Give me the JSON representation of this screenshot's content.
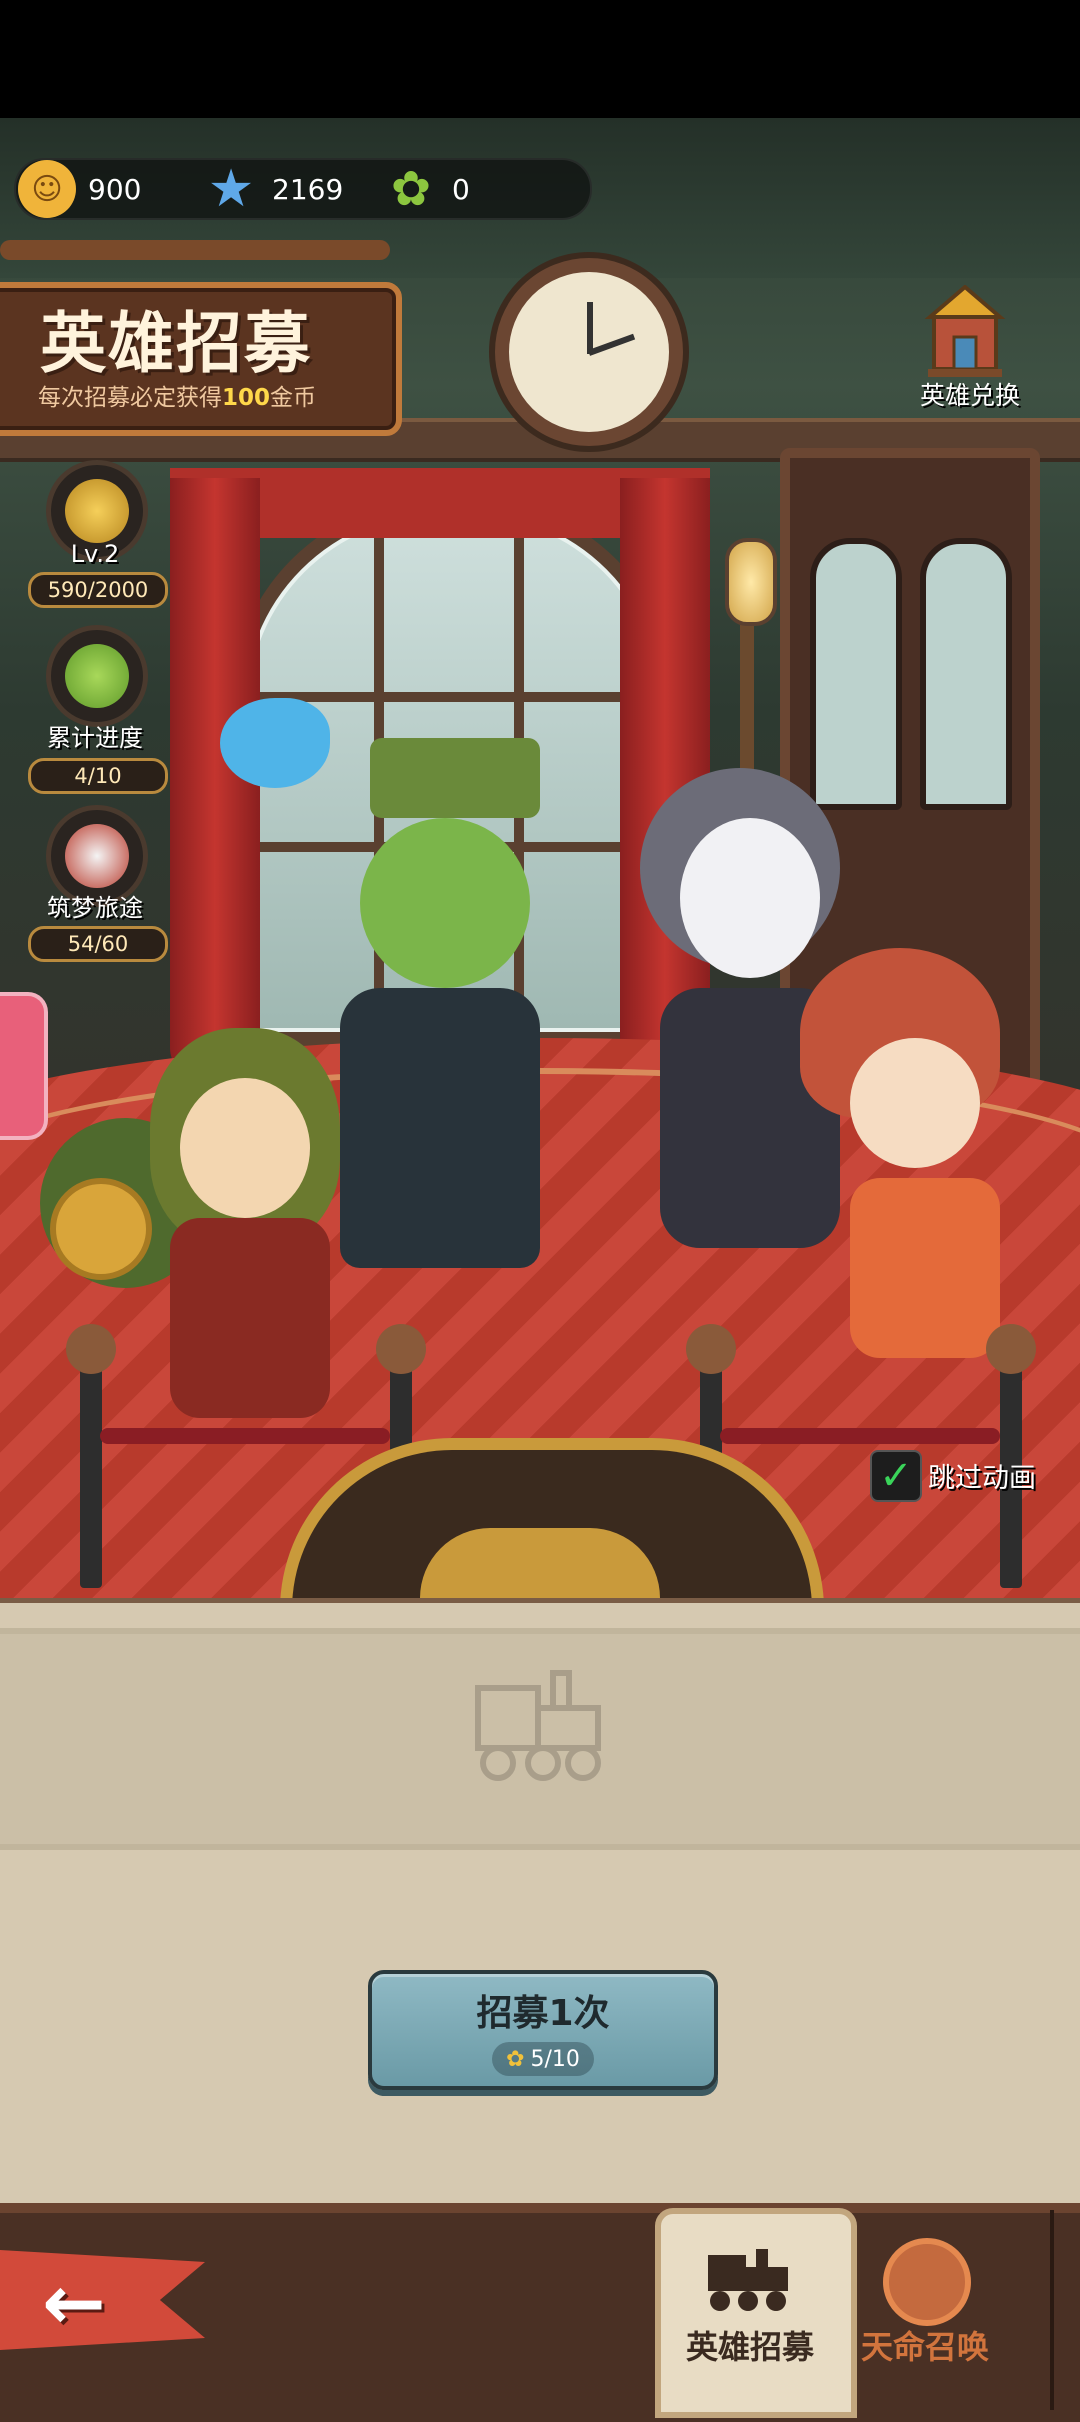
{
  "resources": [
    {
      "name": "gold-coin",
      "value": "900",
      "color": "#f0b43a"
    },
    {
      "name": "blue-star",
      "value": "2169",
      "color": "#5fa8e8"
    },
    {
      "name": "clover",
      "value": "0",
      "color": "#8cc63f"
    }
  ],
  "title": {
    "main": "英雄招募",
    "subtitle_prefix": "每次招募必定获得",
    "subtitle_highlight": "100",
    "subtitle_suffix": "金币"
  },
  "progress": [
    {
      "label": "Lv.2",
      "value": "590/2000",
      "icon": "gold-nugget-icon",
      "fill": 0.295
    },
    {
      "label": "累计进度",
      "value": "4/10",
      "icon": "clover-icon",
      "fill": 0.4
    },
    {
      "label": "筑梦旅途",
      "value": "54/60",
      "icon": "train-mascot-icon",
      "fill": 0.9
    }
  ],
  "exchange": {
    "label": "英雄兑换",
    "icon": "shop-icon"
  },
  "skip_animation": {
    "label": "跳过动画",
    "checked": true
  },
  "recruit": {
    "label": "招募1次",
    "cost": "5/10",
    "cost_icon": "clover-icon"
  },
  "nav": {
    "back_icon": "back-arrow-icon",
    "tabs": [
      {
        "label": "英雄招募",
        "icon": "train-icon",
        "active": true
      },
      {
        "label": "天命召唤",
        "icon": "gear-icon",
        "active": false
      }
    ]
  },
  "colors": {
    "accent": "#6a9aa6",
    "panel": "#d6c9b1",
    "nav": "#4a3024",
    "skip_check": "#3ad45a"
  }
}
